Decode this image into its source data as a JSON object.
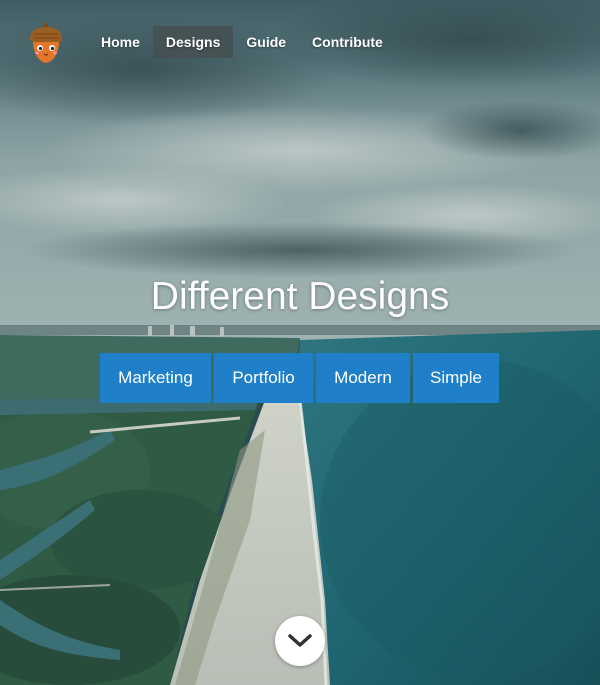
{
  "nav": {
    "logo_icon": "acorn-icon",
    "items": [
      {
        "label": "Home",
        "active": false
      },
      {
        "label": "Designs",
        "active": true
      },
      {
        "label": "Guide",
        "active": false
      },
      {
        "label": "Contribute",
        "active": false
      }
    ]
  },
  "hero": {
    "title": "Different Designs",
    "buttons": [
      {
        "label": "Marketing"
      },
      {
        "label": "Portfolio"
      },
      {
        "label": "Modern"
      },
      {
        "label": "Simple"
      }
    ],
    "scroll_icon": "chevron-down-icon"
  },
  "colors": {
    "accent": "#1f7fc8",
    "nav_active_bg": "#465052",
    "text": "#ffffff"
  }
}
